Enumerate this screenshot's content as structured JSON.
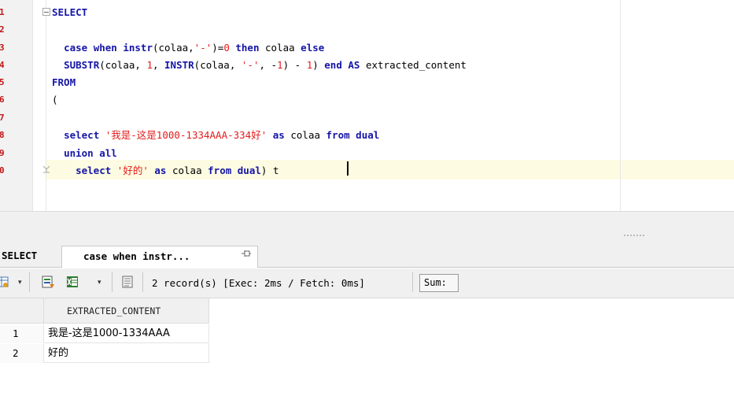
{
  "editor": {
    "line_numbers": [
      "1",
      "2",
      "3",
      "4",
      "5",
      "6",
      "7",
      "8",
      "9",
      "0"
    ],
    "lines": [
      [
        {
          "t": "kw",
          "v": "SELECT"
        }
      ],
      [],
      [
        {
          "t": "txt",
          "v": "  "
        },
        {
          "t": "kw",
          "v": "case"
        },
        {
          "t": "txt",
          "v": " "
        },
        {
          "t": "kw",
          "v": "when"
        },
        {
          "t": "txt",
          "v": " "
        },
        {
          "t": "kw",
          "v": "instr"
        },
        {
          "t": "txt",
          "v": "(colaa,"
        },
        {
          "t": "str",
          "v": "'-'"
        },
        {
          "t": "txt",
          "v": ")="
        },
        {
          "t": "num",
          "v": "0"
        },
        {
          "t": "txt",
          "v": " "
        },
        {
          "t": "kw",
          "v": "then"
        },
        {
          "t": "txt",
          "v": " colaa "
        },
        {
          "t": "kw",
          "v": "else"
        }
      ],
      [
        {
          "t": "txt",
          "v": "  "
        },
        {
          "t": "kw",
          "v": "SUBSTR"
        },
        {
          "t": "txt",
          "v": "(colaa, "
        },
        {
          "t": "num",
          "v": "1"
        },
        {
          "t": "txt",
          "v": ", "
        },
        {
          "t": "kw",
          "v": "INSTR"
        },
        {
          "t": "txt",
          "v": "(colaa, "
        },
        {
          "t": "str",
          "v": "'-'"
        },
        {
          "t": "txt",
          "v": ", -"
        },
        {
          "t": "num",
          "v": "1"
        },
        {
          "t": "txt",
          "v": ") - "
        },
        {
          "t": "num",
          "v": "1"
        },
        {
          "t": "txt",
          "v": ") "
        },
        {
          "t": "kw",
          "v": "end"
        },
        {
          "t": "txt",
          "v": " "
        },
        {
          "t": "kw",
          "v": "AS"
        },
        {
          "t": "txt",
          "v": " extracted_content"
        }
      ],
      [
        {
          "t": "kw",
          "v": "FROM"
        }
      ],
      [
        {
          "t": "txt",
          "v": "("
        }
      ],
      [],
      [
        {
          "t": "txt",
          "v": "  "
        },
        {
          "t": "kw",
          "v": "select"
        },
        {
          "t": "txt",
          "v": " "
        },
        {
          "t": "str",
          "v": "'我是-这是1000-1334AAA-334好'"
        },
        {
          "t": "txt",
          "v": " "
        },
        {
          "t": "kw",
          "v": "as"
        },
        {
          "t": "txt",
          "v": " colaa "
        },
        {
          "t": "kw",
          "v": "from"
        },
        {
          "t": "txt",
          "v": " "
        },
        {
          "t": "kw",
          "v": "dual"
        }
      ],
      [
        {
          "t": "txt",
          "v": "  "
        },
        {
          "t": "kw",
          "v": "union"
        },
        {
          "t": "txt",
          "v": " "
        },
        {
          "t": "kw",
          "v": "all"
        }
      ],
      [
        {
          "t": "txt",
          "v": "    "
        },
        {
          "t": "kw",
          "v": "select"
        },
        {
          "t": "txt",
          "v": " "
        },
        {
          "t": "str",
          "v": "'好的'"
        },
        {
          "t": "txt",
          "v": " "
        },
        {
          "t": "kw",
          "v": "as"
        },
        {
          "t": "txt",
          "v": " colaa "
        },
        {
          "t": "kw",
          "v": "from"
        },
        {
          "t": "txt",
          "v": " "
        },
        {
          "t": "kw",
          "v": "dual"
        },
        {
          "t": "txt",
          "v": ") t"
        }
      ]
    ]
  },
  "result_tabs": {
    "tab1_label": "SELECT",
    "tab2_label": "case when instr..."
  },
  "toolbar": {
    "records_text": "2 record(s) [Exec: 2ms / Fetch: 0ms]",
    "sum_label": "Sum:",
    "dropdown_glyph": "▾"
  },
  "grid": {
    "column_header": "EXTRACTED_CONTENT",
    "rows": [
      {
        "num": "1",
        "value": "我是-这是1000-1334AAA"
      },
      {
        "num": "2",
        "value": "好的"
      }
    ]
  },
  "colors": {
    "keyword": "#1515a8",
    "string": "#e21c1c",
    "line_number": "#c01818",
    "current_line": "#fdfbe1"
  },
  "icons": [
    "fold-minus-icon",
    "pin-icon",
    "table-options-icon",
    "export-icon",
    "excel-icon",
    "page-icon"
  ]
}
